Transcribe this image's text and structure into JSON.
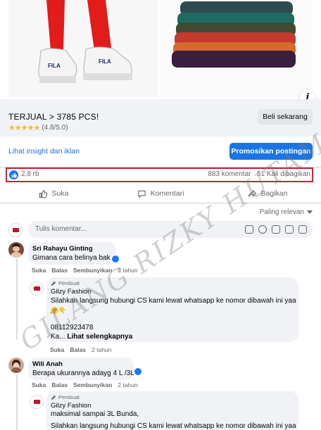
{
  "post": {
    "title": "TERJUAL > 3785 PCS!",
    "rating_text": "(4.8/5.0)",
    "rating_value": 4.8,
    "buy_label": "Beli sekarang",
    "insight_link": "Lihat insight dan iklan",
    "promote_label": "Promosikan postingan"
  },
  "stats": {
    "reactions": "2,8 rb",
    "comments": "883 komentar",
    "shares": "51 Kali dibagikan"
  },
  "actions": {
    "like": "Suka",
    "comment": "Komentari",
    "share": "Bagikan"
  },
  "sort_label": "Paling relevan",
  "composer": {
    "placeholder": "Tulis komentar..."
  },
  "comments": [
    {
      "name": "Sri Rahayu Ginting",
      "text": "Gimana cara belinya bak",
      "actions": [
        "Suka",
        "Balas",
        "Sembunyikan"
      ],
      "time": "2 tahun",
      "reply": {
        "tag": "Pembuat",
        "name": "Gilzy Fashion",
        "text": "Silahkan langsung hubungi CS kami lewat whatsapp ke nomor dibawah ini yaa",
        "emoji": "🤗👇",
        "phone": "08112923478",
        "more_prefix": "Ka...",
        "more_link": "Lihat selengkapnya",
        "actions": [
          "Suka",
          "Balas"
        ],
        "time": "2 tahun"
      }
    },
    {
      "name": "Wili Anah",
      "text": "Berapa ukurannya adayg 4 L /3L",
      "actions": [
        "Suka",
        "Balas",
        "Sembunyikan"
      ],
      "time": "2 tahun",
      "reply": {
        "tag": "Pembuat",
        "name": "Gilzy Fashion",
        "text": "maksimal sampai 3L Bunda,",
        "text2": "Silahkan langsung hubungi CS kami lewat whatsapp ke nomor dibawah ini yaa"
      }
    }
  ],
  "watermark": "GILANG RIZKY HUTAMA",
  "colors": {
    "accent": "#1b74e4",
    "highlight_border": "#c1273c",
    "link": "#216fdb"
  }
}
